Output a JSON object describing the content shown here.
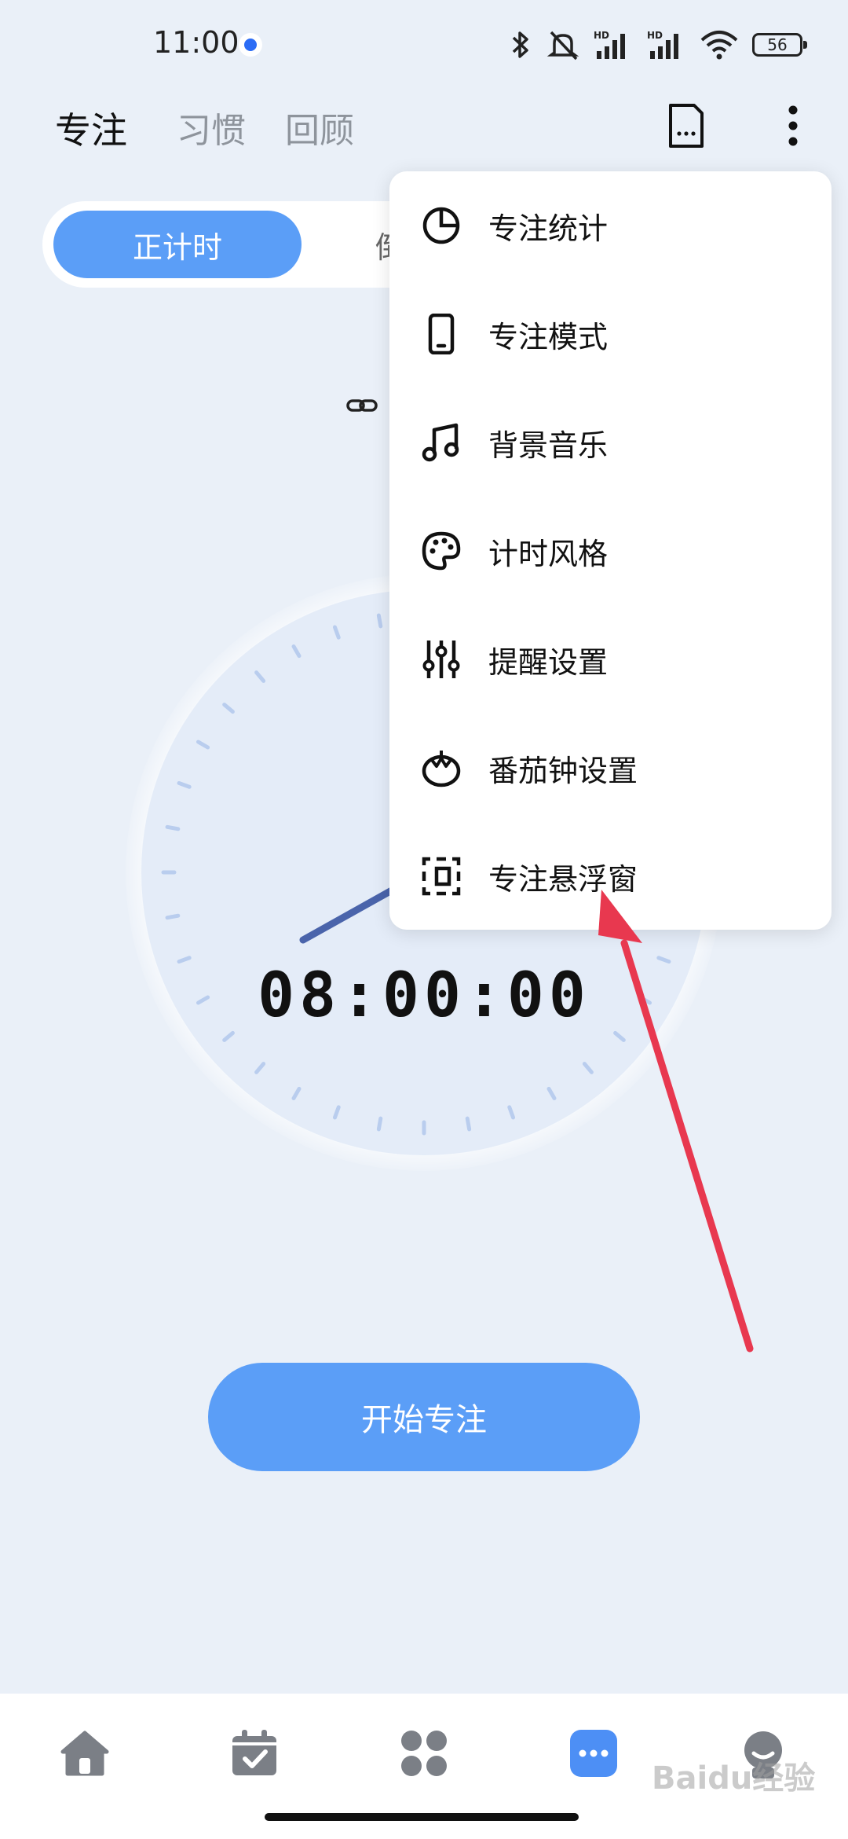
{
  "status_bar": {
    "time": "11:00",
    "battery": "56"
  },
  "header": {
    "tabs": [
      {
        "label": "专注",
        "active": true
      },
      {
        "label": "习惯",
        "active": false
      },
      {
        "label": "回顾",
        "active": false
      }
    ]
  },
  "segment": {
    "active_label": "正计时",
    "other_label": "倒"
  },
  "timer": {
    "display": "08:00:00"
  },
  "start_button": {
    "label": "开始专注"
  },
  "menu": {
    "items": [
      {
        "label": "专注统计",
        "icon": "pie-chart-icon"
      },
      {
        "label": "专注模式",
        "icon": "phone-icon"
      },
      {
        "label": "背景音乐",
        "icon": "music-note-icon"
      },
      {
        "label": "计时风格",
        "icon": "palette-icon"
      },
      {
        "label": "提醒设置",
        "icon": "sliders-icon"
      },
      {
        "label": "番茄钟设置",
        "icon": "tomato-icon"
      },
      {
        "label": "专注悬浮窗",
        "icon": "floating-window-icon"
      }
    ]
  },
  "bottom_nav": [
    "home-icon",
    "calendar-check-icon",
    "apps-grid-icon",
    "focus-icon",
    "profile-icon"
  ],
  "watermark": "Baidu经验",
  "colors": {
    "accent": "#5b9ef7",
    "background": "#eaf0f8",
    "arrow": "#e8384f",
    "dial": "#e4ecf8",
    "hand": "#4a64ab"
  }
}
